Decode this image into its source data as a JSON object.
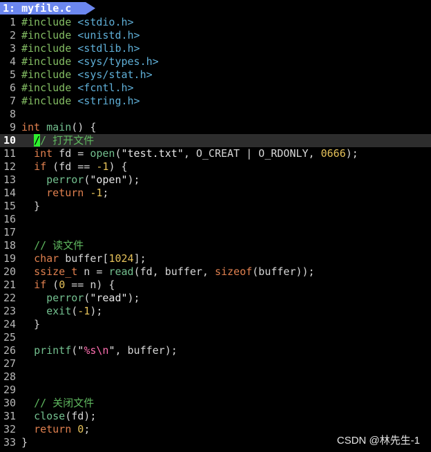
{
  "tabline": {
    "tab_label": "1: myfile.c"
  },
  "editor": {
    "lines": [
      {
        "n": "1",
        "t": [
          {
            "c": "pp",
            "s": "#include "
          },
          {
            "c": "inc",
            "s": "<stdio.h>"
          }
        ]
      },
      {
        "n": "2",
        "t": [
          {
            "c": "pp",
            "s": "#include "
          },
          {
            "c": "inc",
            "s": "<unistd.h>"
          }
        ]
      },
      {
        "n": "3",
        "t": [
          {
            "c": "pp",
            "s": "#include "
          },
          {
            "c": "inc",
            "s": "<stdlib.h>"
          }
        ]
      },
      {
        "n": "4",
        "t": [
          {
            "c": "pp",
            "s": "#include "
          },
          {
            "c": "inc",
            "s": "<sys/types.h>"
          }
        ]
      },
      {
        "n": "5",
        "t": [
          {
            "c": "pp",
            "s": "#include "
          },
          {
            "c": "inc",
            "s": "<sys/stat.h>"
          }
        ]
      },
      {
        "n": "6",
        "t": [
          {
            "c": "pp",
            "s": "#include "
          },
          {
            "c": "inc",
            "s": "<fcntl.h>"
          }
        ]
      },
      {
        "n": "7",
        "t": [
          {
            "c": "pp",
            "s": "#include "
          },
          {
            "c": "inc",
            "s": "<string.h>"
          }
        ]
      },
      {
        "n": "8",
        "t": []
      },
      {
        "n": "9",
        "t": [
          {
            "c": "type",
            "s": "int"
          },
          {
            "c": "plain",
            "s": " "
          },
          {
            "c": "fn",
            "s": "main"
          },
          {
            "c": "plain",
            "s": "() {"
          }
        ]
      },
      {
        "n": "10",
        "cursorline": true,
        "t": [
          {
            "c": "plain",
            "s": "  "
          },
          {
            "c": "cursor",
            "s": "/"
          },
          {
            "c": "cm",
            "s": "/ 打开文件"
          }
        ]
      },
      {
        "n": "11",
        "t": [
          {
            "c": "plain",
            "s": "  "
          },
          {
            "c": "type",
            "s": "int"
          },
          {
            "c": "plain",
            "s": " fd = "
          },
          {
            "c": "fn",
            "s": "open"
          },
          {
            "c": "plain",
            "s": "("
          },
          {
            "c": "str",
            "s": "\"test.txt\""
          },
          {
            "c": "plain",
            "s": ", O_CREAT | O_RDONLY, "
          },
          {
            "c": "num",
            "s": "0666"
          },
          {
            "c": "plain",
            "s": ");"
          }
        ]
      },
      {
        "n": "12",
        "t": [
          {
            "c": "plain",
            "s": "  "
          },
          {
            "c": "type",
            "s": "if"
          },
          {
            "c": "plain",
            "s": " (fd == "
          },
          {
            "c": "num",
            "s": "-1"
          },
          {
            "c": "plain",
            "s": ") {"
          }
        ]
      },
      {
        "n": "13",
        "t": [
          {
            "c": "plain",
            "s": "    "
          },
          {
            "c": "fn",
            "s": "perror"
          },
          {
            "c": "plain",
            "s": "("
          },
          {
            "c": "str",
            "s": "\"open\""
          },
          {
            "c": "plain",
            "s": ");"
          }
        ]
      },
      {
        "n": "14",
        "t": [
          {
            "c": "plain",
            "s": "    "
          },
          {
            "c": "type",
            "s": "return"
          },
          {
            "c": "plain",
            "s": " "
          },
          {
            "c": "num",
            "s": "-1"
          },
          {
            "c": "plain",
            "s": ";"
          }
        ]
      },
      {
        "n": "15",
        "t": [
          {
            "c": "plain",
            "s": "  }"
          }
        ]
      },
      {
        "n": "16",
        "t": []
      },
      {
        "n": "17",
        "t": []
      },
      {
        "n": "18",
        "t": [
          {
            "c": "plain",
            "s": "  "
          },
          {
            "c": "cm",
            "s": "// 读文件"
          }
        ]
      },
      {
        "n": "19",
        "t": [
          {
            "c": "plain",
            "s": "  "
          },
          {
            "c": "type",
            "s": "char"
          },
          {
            "c": "plain",
            "s": " buffer["
          },
          {
            "c": "num",
            "s": "1024"
          },
          {
            "c": "plain",
            "s": "];"
          }
        ]
      },
      {
        "n": "20",
        "t": [
          {
            "c": "plain",
            "s": "  "
          },
          {
            "c": "type",
            "s": "ssize_t"
          },
          {
            "c": "plain",
            "s": " n = "
          },
          {
            "c": "fn",
            "s": "read"
          },
          {
            "c": "plain",
            "s": "(fd, buffer, "
          },
          {
            "c": "type",
            "s": "sizeof"
          },
          {
            "c": "plain",
            "s": "(buffer));"
          }
        ]
      },
      {
        "n": "21",
        "t": [
          {
            "c": "plain",
            "s": "  "
          },
          {
            "c": "type",
            "s": "if"
          },
          {
            "c": "plain",
            "s": " ("
          },
          {
            "c": "num",
            "s": "0"
          },
          {
            "c": "plain",
            "s": " == n) {"
          }
        ]
      },
      {
        "n": "22",
        "t": [
          {
            "c": "plain",
            "s": "    "
          },
          {
            "c": "fn",
            "s": "perror"
          },
          {
            "c": "plain",
            "s": "("
          },
          {
            "c": "str",
            "s": "\"read\""
          },
          {
            "c": "plain",
            "s": ");"
          }
        ]
      },
      {
        "n": "23",
        "t": [
          {
            "c": "plain",
            "s": "    "
          },
          {
            "c": "fn",
            "s": "exit"
          },
          {
            "c": "plain",
            "s": "("
          },
          {
            "c": "num",
            "s": "-1"
          },
          {
            "c": "plain",
            "s": ");"
          }
        ]
      },
      {
        "n": "24",
        "t": [
          {
            "c": "plain",
            "s": "  }"
          }
        ]
      },
      {
        "n": "25",
        "t": []
      },
      {
        "n": "26",
        "t": [
          {
            "c": "plain",
            "s": "  "
          },
          {
            "c": "fn",
            "s": "printf"
          },
          {
            "c": "plain",
            "s": "("
          },
          {
            "c": "str",
            "s": "\""
          },
          {
            "c": "esc",
            "s": "%s\\n"
          },
          {
            "c": "str",
            "s": "\""
          },
          {
            "c": "plain",
            "s": ", buffer);"
          }
        ]
      },
      {
        "n": "27",
        "t": []
      },
      {
        "n": "28",
        "t": []
      },
      {
        "n": "29",
        "t": []
      },
      {
        "n": "30",
        "t": [
          {
            "c": "plain",
            "s": "  "
          },
          {
            "c": "cm",
            "s": "// 关闭文件"
          }
        ]
      },
      {
        "n": "31",
        "t": [
          {
            "c": "plain",
            "s": "  "
          },
          {
            "c": "fn",
            "s": "close"
          },
          {
            "c": "plain",
            "s": "(fd);"
          }
        ]
      },
      {
        "n": "32",
        "t": [
          {
            "c": "plain",
            "s": "  "
          },
          {
            "c": "type",
            "s": "return"
          },
          {
            "c": "plain",
            "s": " "
          },
          {
            "c": "num",
            "s": "0"
          },
          {
            "c": "plain",
            "s": ";"
          }
        ]
      },
      {
        "n": "33",
        "t": [
          {
            "c": "plain",
            "s": "}"
          }
        ]
      }
    ]
  },
  "watermark": {
    "text": "CSDN @林先生-1"
  }
}
